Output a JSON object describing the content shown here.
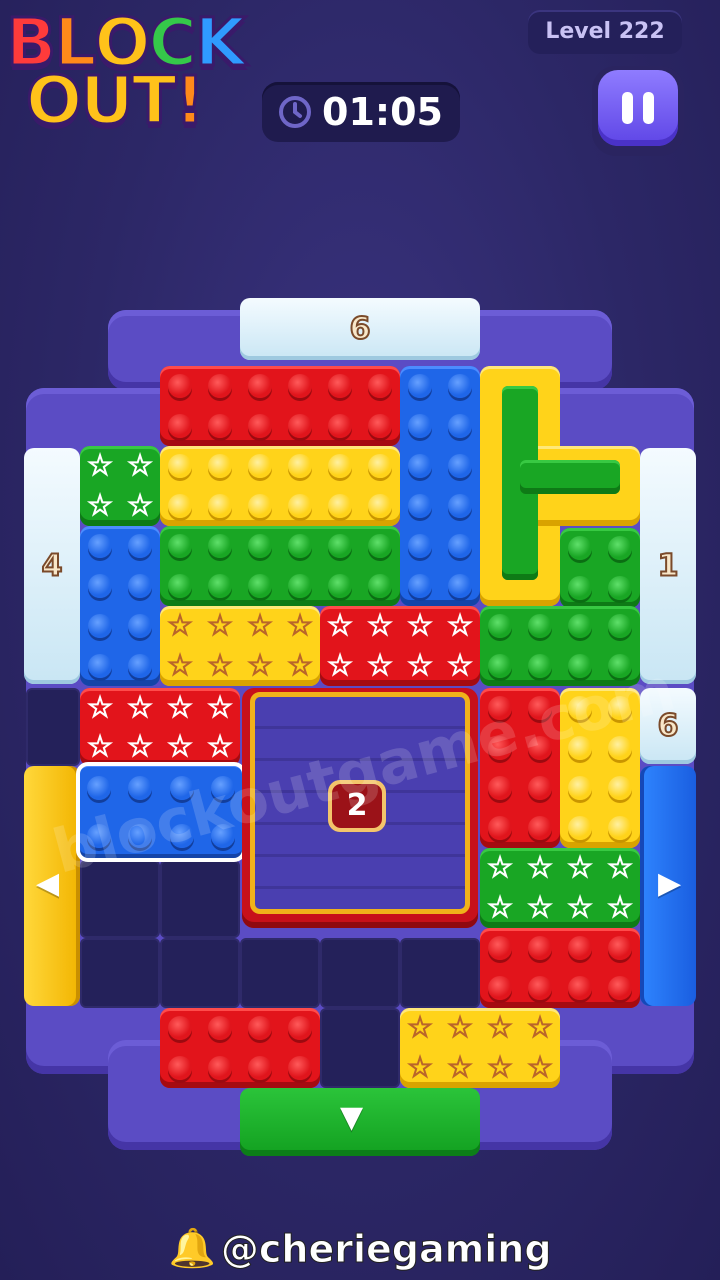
{
  "header": {
    "logo_line1": "BLOCK",
    "logo_line2": "OUT!",
    "level": "Level 222",
    "timer": "01:05",
    "pause_icon": "pause-icon",
    "clock_icon": "clock-icon"
  },
  "gates": {
    "top": "6",
    "left": "4",
    "right_upper": "1",
    "right_lower": "6"
  },
  "locked_block": {
    "counter": "2"
  },
  "watermark": "blockoutgame.com",
  "footer": {
    "bell_icon": "bell-icon",
    "handle": "@cheriegaming"
  },
  "colors": {
    "background": "#2c2766",
    "frame": "#5b4cc4",
    "red": "#e2141b",
    "blue": "#1f66e8",
    "yellow": "#ffd31a",
    "green": "#19a624"
  }
}
